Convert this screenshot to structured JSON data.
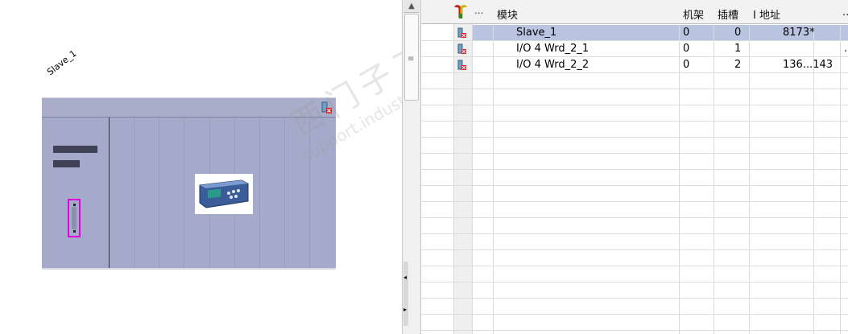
{
  "device_view": {
    "device_label": "Slave_1"
  },
  "watermark": {
    "line1": "西门子工业  技术论坛",
    "line2": "support.industry.siemens.com/cs"
  },
  "table": {
    "headers": {
      "dots": "...",
      "module": "模块",
      "rack": "机架",
      "slot": "插槽",
      "iaddress": "I 地址",
      "more": "..."
    },
    "rows": [
      {
        "module": "Slave_1",
        "rack": "0",
        "slot": "0",
        "iaddress": "8173*",
        "selected": true
      },
      {
        "module": "I/O 4 Wrd_2_1",
        "rack": "0",
        "slot": "1",
        "iaddress": "",
        "extra": "."
      },
      {
        "module": "I/O 4 Wrd_2_2",
        "rack": "0",
        "slot": "2",
        "iaddress": "136...143"
      }
    ]
  },
  "colors": {
    "rack_body": "#a6aaca",
    "selection": "#b8c4e0",
    "port_highlight": "#e000e0",
    "error_icon": "#e02020"
  }
}
